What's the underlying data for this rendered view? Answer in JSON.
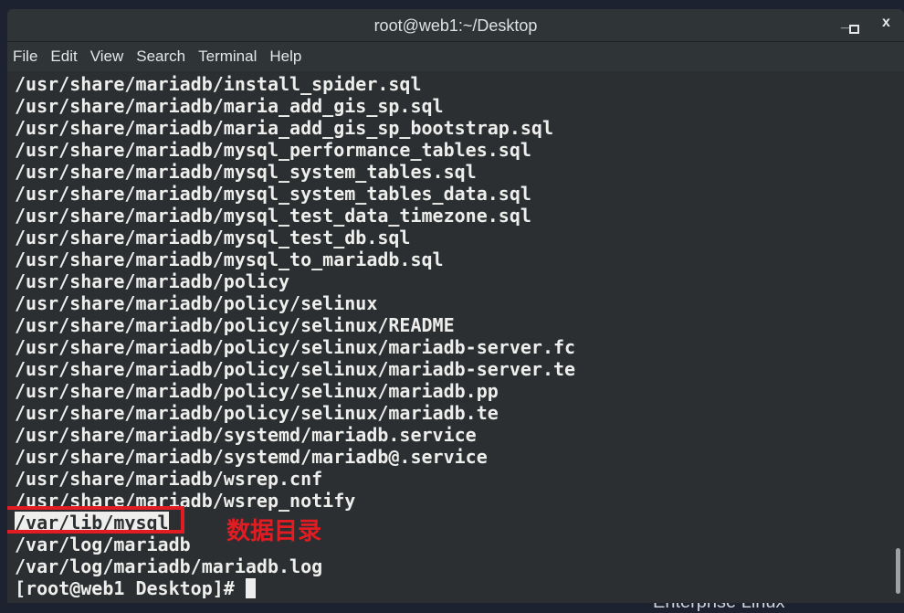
{
  "window": {
    "title": "root@web1:~/Desktop",
    "controls": [
      "_",
      "▫",
      "x"
    ]
  },
  "menu": [
    "File",
    "Edit",
    "View",
    "Search",
    "Terminal",
    "Help"
  ],
  "terminal": {
    "lines": [
      "/usr/share/mariadb/install_spider.sql",
      "/usr/share/mariadb/maria_add_gis_sp.sql",
      "/usr/share/mariadb/maria_add_gis_sp_bootstrap.sql",
      "/usr/share/mariadb/mysql_performance_tables.sql",
      "/usr/share/mariadb/mysql_system_tables.sql",
      "/usr/share/mariadb/mysql_system_tables_data.sql",
      "/usr/share/mariadb/mysql_test_data_timezone.sql",
      "/usr/share/mariadb/mysql_test_db.sql",
      "/usr/share/mariadb/mysql_to_mariadb.sql",
      "/usr/share/mariadb/policy",
      "/usr/share/mariadb/policy/selinux",
      "/usr/share/mariadb/policy/selinux/README",
      "/usr/share/mariadb/policy/selinux/mariadb-server.fc",
      "/usr/share/mariadb/policy/selinux/mariadb-server.te",
      "/usr/share/mariadb/policy/selinux/mariadb.pp",
      "/usr/share/mariadb/policy/selinux/mariadb.te",
      "/usr/share/mariadb/systemd/mariadb.service",
      "/usr/share/mariadb/systemd/mariadb@.service",
      "/usr/share/mariadb/wsrep.cnf",
      "/usr/share/mariadb/wsrep_notify"
    ],
    "highlighted_line": "/var/lib/mysql",
    "after_lines": [
      "/var/log/mariadb",
      "/var/log/mariadb/mariadb.log"
    ],
    "prompt": "[root@web1 Desktop]#"
  },
  "annotation": {
    "text": "数据目录",
    "color": "#e21c23"
  },
  "desktop_text": "Enterprise Linux"
}
